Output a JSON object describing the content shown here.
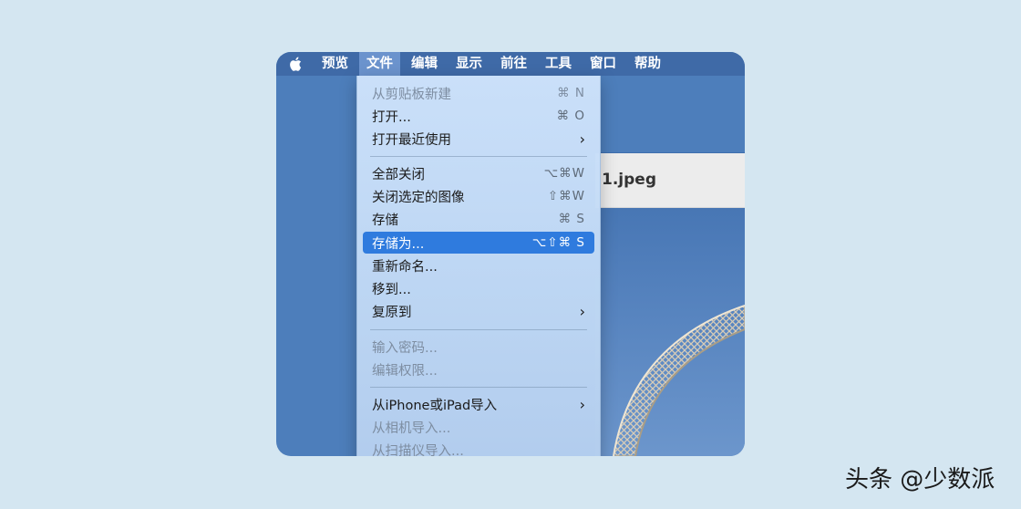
{
  "menubar": {
    "items": [
      "预览",
      "文件",
      "编辑",
      "显示",
      "前往",
      "工具",
      "窗口",
      "帮助"
    ],
    "active": "文件"
  },
  "document": {
    "title": "1.jpeg"
  },
  "file_menu": {
    "items": [
      {
        "label": "从剪贴板新建",
        "shortcut": "⌘ N",
        "disabled": true
      },
      {
        "label": "打开...",
        "shortcut": "⌘ O"
      },
      {
        "label": "打开最近使用",
        "submenu": true
      },
      {
        "label": "全部关闭",
        "shortcut": "⌥⌘W"
      },
      {
        "label": "关闭选定的图像",
        "shortcut": "⇧⌘W"
      },
      {
        "label": "存储",
        "shortcut": "⌘ S"
      },
      {
        "label": "存储为...",
        "shortcut": "⌥⇧⌘ S",
        "selected": true
      },
      {
        "label": "重新命名..."
      },
      {
        "label": "移到..."
      },
      {
        "label": "复原到",
        "submenu": true
      },
      {
        "label": "输入密码...",
        "disabled": true
      },
      {
        "label": "编辑权限...",
        "disabled": true
      },
      {
        "label": "从iPhone或iPad导入",
        "submenu": true
      },
      {
        "label": "从相机导入...",
        "disabled": true
      },
      {
        "label": "从扫描仪导入...",
        "disabled": true
      }
    ],
    "submenu_glyph": "›"
  },
  "watermark": "头条 @少数派",
  "colors": {
    "background": "#d4e6f1",
    "menubar": "#3f6aa7",
    "selection": "#2f7bde",
    "desktop": "#4d7ebb"
  },
  "icons": {
    "apple": "apple-logo-icon",
    "submenu": "chevron-right-icon"
  }
}
